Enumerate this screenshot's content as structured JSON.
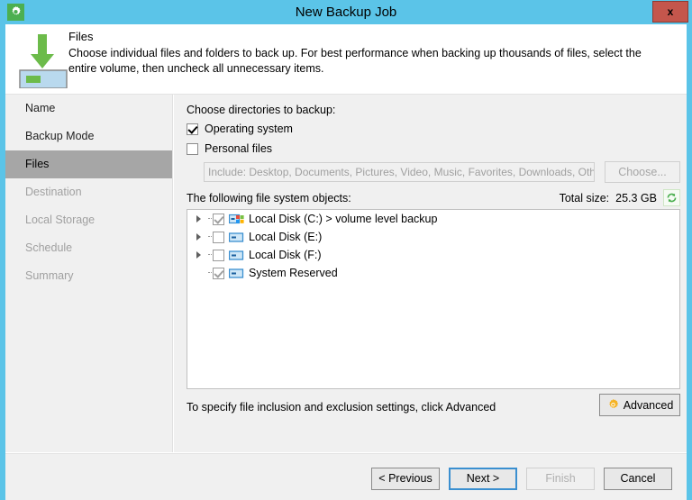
{
  "window": {
    "title": "New Backup Job",
    "app_icon": "gear-icon",
    "close_label": "x",
    "titlebar_color": "#5bc4e8"
  },
  "header": {
    "title": "Files",
    "description": "Choose individual files and folders to back up. For best performance when backing up thousands of files, select the entire volume, then uncheck all unnecessary items.",
    "icon": "download-to-volume-icon"
  },
  "sidebar": {
    "items": [
      {
        "label": "Name",
        "state": "normal"
      },
      {
        "label": "Backup Mode",
        "state": "normal"
      },
      {
        "label": "Files",
        "state": "active"
      },
      {
        "label": "Destination",
        "state": "dim"
      },
      {
        "label": "Local Storage",
        "state": "dim"
      },
      {
        "label": "Schedule",
        "state": "dim"
      },
      {
        "label": "Summary",
        "state": "dim"
      }
    ]
  },
  "main": {
    "choose_dirs_label": "Choose directories to backup:",
    "operating_system": {
      "label": "Operating system",
      "checked": true
    },
    "personal_files": {
      "label": "Personal files",
      "checked": false
    },
    "include_field_value": "Include: Desktop, Documents, Pictures, Video, Music, Favorites, Downloads, Other",
    "choose_button_label": "Choose...",
    "objects_label": "The following file system objects:",
    "total_size_label": "Total size:",
    "total_size_value": "25.3 GB",
    "refresh_icon": "refresh-icon",
    "tree": [
      {
        "label": "Local Disk (C:) > volume level backup",
        "checked": true,
        "expandable": true,
        "icon": "os-drive-icon"
      },
      {
        "label": "Local Disk (E:)",
        "checked": false,
        "expandable": true,
        "icon": "drive-icon"
      },
      {
        "label": "Local Disk (F:)",
        "checked": false,
        "expandable": true,
        "icon": "drive-icon"
      },
      {
        "label": "System Reserved",
        "checked": true,
        "expandable": false,
        "icon": "drive-icon"
      }
    ],
    "advanced_hint": "To specify file inclusion and exclusion settings, click Advanced",
    "advanced_button_label": "Advanced",
    "advanced_icon": "gear-icon"
  },
  "footer": {
    "previous_label": "< Previous",
    "next_label": "Next >",
    "finish_label": "Finish",
    "cancel_label": "Cancel"
  },
  "colors": {
    "accent": "#5bc4e8",
    "selection": "#a6a6a6",
    "close": "#c4564c",
    "app_icon": "#4caf50",
    "default_button_border": "#3a8fd0"
  }
}
